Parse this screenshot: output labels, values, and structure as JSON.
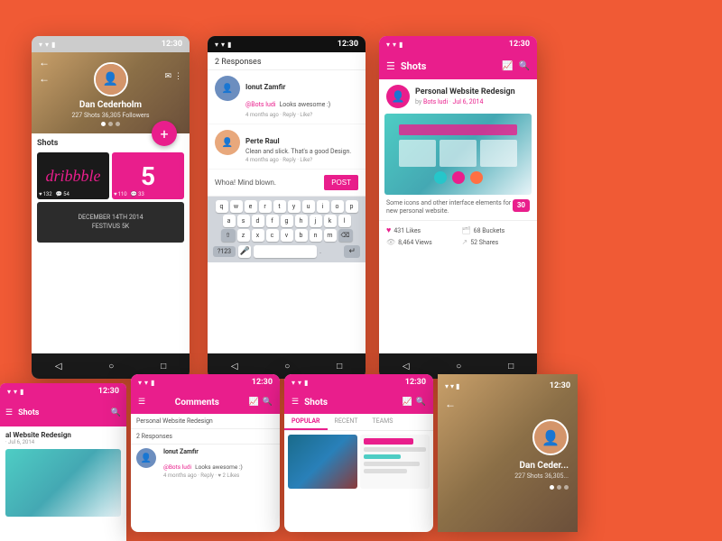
{
  "phone1": {
    "status_time": "12:30",
    "profile_name": "Dan Cederholm",
    "profile_stats": "227 Shots  36,305 Followers",
    "shots_label": "Shots",
    "shot1_likes": "132",
    "shot1_comments": "54",
    "shot2_likes": "110",
    "shot2_comments": "33",
    "nav_back": "◁",
    "nav_home": "○",
    "nav_square": "□"
  },
  "phone2": {
    "status_time": "12:30",
    "responses_count": "2 Responses",
    "comment1_user": "Ionut Zamfir",
    "comment1_mention": "@Bots ludi",
    "comment1_text": "Looks awesome :)",
    "comment1_meta": "4 months ago · Reply · Like?",
    "comment2_user": "Perte Raul",
    "comment2_text": "Clean and slick. That's a good Design.",
    "comment2_meta": "4 months ago · Reply · Like?",
    "input_placeholder": "Whoa! Mind blown.",
    "post_label": "POST",
    "keyboard_rows": [
      [
        "q",
        "w",
        "e",
        "r",
        "t",
        "y",
        "u",
        "i",
        "o",
        "p"
      ],
      [
        "a",
        "s",
        "d",
        "f",
        "g",
        "h",
        "j",
        "k",
        "l"
      ],
      [
        "z",
        "x",
        "c",
        "v",
        "b",
        "n",
        "m"
      ]
    ]
  },
  "phone3": {
    "status_time": "12:30",
    "app_title": "Shots",
    "shot_title": "Personal Website Redesign",
    "shot_author": "Bots ludi",
    "shot_date": "Jul 6, 2014",
    "shot_desc": "Some icons and other interface elements for my new personal website.",
    "responses": "30",
    "likes": "431 Likes",
    "views": "8,464 Views",
    "buckets": "68 Buckets",
    "shares": "52 Shares"
  },
  "bottom1": {
    "status_time": "12:30",
    "title": "al Website Redesign",
    "sub": "· Jul 6, 2014"
  },
  "bottom2": {
    "status_time": "12:30",
    "bar_title": "Comments",
    "sub_header": "Personal Website Redesign",
    "responses_count": "2 Responses",
    "comment1_user": "Ionut Zamfir",
    "comment1_mention": "@Bots ludi",
    "comment1_text": "Looks awesome :)",
    "comment1_meta": "4 months ago · Reply ·",
    "comment1_likes": "2 Likes"
  },
  "bottom3": {
    "status_time": "12:30",
    "bar_title": "Shots",
    "tab_popular": "POPULAR",
    "tab_recent": "RECENT",
    "tab_teams": "TEAMS"
  },
  "bottom4": {
    "status_time": "12:30",
    "profile_name": "Dan Ceder...",
    "profile_stats": "227 Shots  36,305..."
  }
}
